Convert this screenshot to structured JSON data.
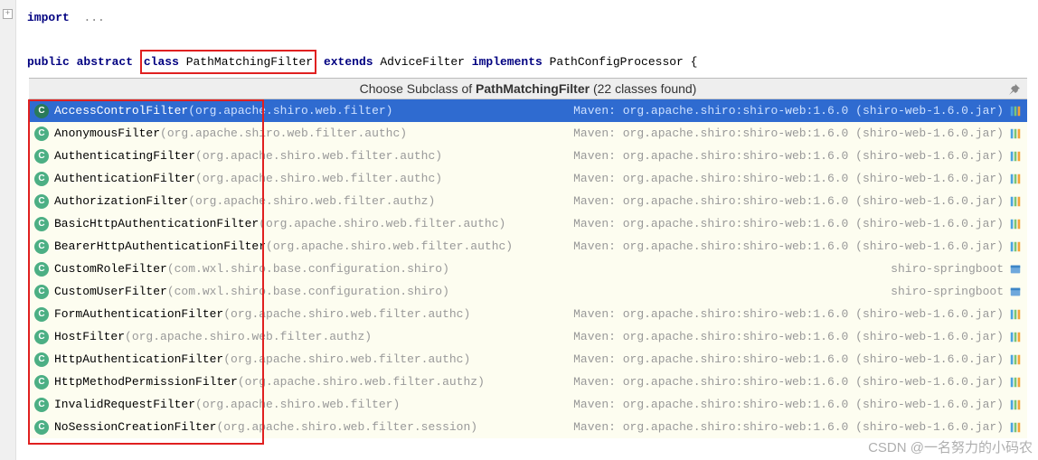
{
  "code": {
    "import_kw": "import",
    "import_rest": "...",
    "decl_public": "public",
    "decl_abstract": "abstract",
    "decl_class": "class",
    "decl_name": "PathMatchingFilter",
    "decl_extends": "extends",
    "decl_parent": "AdviceFilter",
    "decl_implements": "implements",
    "decl_iface": "PathConfigProcessor",
    "decl_brace": "{"
  },
  "popup": {
    "title_prefix": "Choose Subclass of ",
    "title_class": "PathMatchingFilter",
    "title_suffix": " (22 classes found)",
    "items": [
      {
        "name": "AccessControlFilter",
        "pkg": "(org.apache.shiro.web.filter)",
        "right": "Maven: org.apache.shiro:shiro-web:1.6.0 (shiro-web-1.6.0.jar)",
        "kind": "jar",
        "sel": true
      },
      {
        "name": "AnonymousFilter",
        "pkg": "(org.apache.shiro.web.filter.authc)",
        "right": "Maven: org.apache.shiro:shiro-web:1.6.0 (shiro-web-1.6.0.jar)",
        "kind": "jar"
      },
      {
        "name": "AuthenticatingFilter",
        "pkg": "(org.apache.shiro.web.filter.authc)",
        "right": "Maven: org.apache.shiro:shiro-web:1.6.0 (shiro-web-1.6.0.jar)",
        "kind": "jar"
      },
      {
        "name": "AuthenticationFilter",
        "pkg": "(org.apache.shiro.web.filter.authc)",
        "right": "Maven: org.apache.shiro:shiro-web:1.6.0 (shiro-web-1.6.0.jar)",
        "kind": "jar"
      },
      {
        "name": "AuthorizationFilter",
        "pkg": "(org.apache.shiro.web.filter.authz)",
        "right": "Maven: org.apache.shiro:shiro-web:1.6.0 (shiro-web-1.6.0.jar)",
        "kind": "jar"
      },
      {
        "name": "BasicHttpAuthenticationFilter",
        "pkg": "(org.apache.shiro.web.filter.authc)",
        "right": "Maven: org.apache.shiro:shiro-web:1.6.0 (shiro-web-1.6.0.jar)",
        "kind": "jar"
      },
      {
        "name": "BearerHttpAuthenticationFilter",
        "pkg": "(org.apache.shiro.web.filter.authc)",
        "right": "Maven: org.apache.shiro:shiro-web:1.6.0 (shiro-web-1.6.0.jar)",
        "kind": "jar"
      },
      {
        "name": "CustomRoleFilter",
        "pkg": "(com.wxl.shiro.base.configuration.shiro)",
        "right": "shiro-springboot",
        "kind": "module"
      },
      {
        "name": "CustomUserFilter",
        "pkg": "(com.wxl.shiro.base.configuration.shiro)",
        "right": "shiro-springboot",
        "kind": "module"
      },
      {
        "name": "FormAuthenticationFilter",
        "pkg": "(org.apache.shiro.web.filter.authc)",
        "right": "Maven: org.apache.shiro:shiro-web:1.6.0 (shiro-web-1.6.0.jar)",
        "kind": "jar"
      },
      {
        "name": "HostFilter",
        "pkg": "(org.apache.shiro.web.filter.authz)",
        "right": "Maven: org.apache.shiro:shiro-web:1.6.0 (shiro-web-1.6.0.jar)",
        "kind": "jar"
      },
      {
        "name": "HttpAuthenticationFilter",
        "pkg": "(org.apache.shiro.web.filter.authc)",
        "right": "Maven: org.apache.shiro:shiro-web:1.6.0 (shiro-web-1.6.0.jar)",
        "kind": "jar"
      },
      {
        "name": "HttpMethodPermissionFilter",
        "pkg": "(org.apache.shiro.web.filter.authz)",
        "right": "Maven: org.apache.shiro:shiro-web:1.6.0 (shiro-web-1.6.0.jar)",
        "kind": "jar"
      },
      {
        "name": "InvalidRequestFilter",
        "pkg": "(org.apache.shiro.web.filter)",
        "right": "Maven: org.apache.shiro:shiro-web:1.6.0 (shiro-web-1.6.0.jar)",
        "kind": "jar"
      },
      {
        "name": "NoSessionCreationFilter",
        "pkg": "(org.apache.shiro.web.filter.session)",
        "right": "Maven: org.apache.shiro:shiro-web:1.6.0 (shiro-web-1.6.0.jar)",
        "kind": "jar"
      }
    ]
  },
  "watermark": "CSDN @一名努力的小码农"
}
